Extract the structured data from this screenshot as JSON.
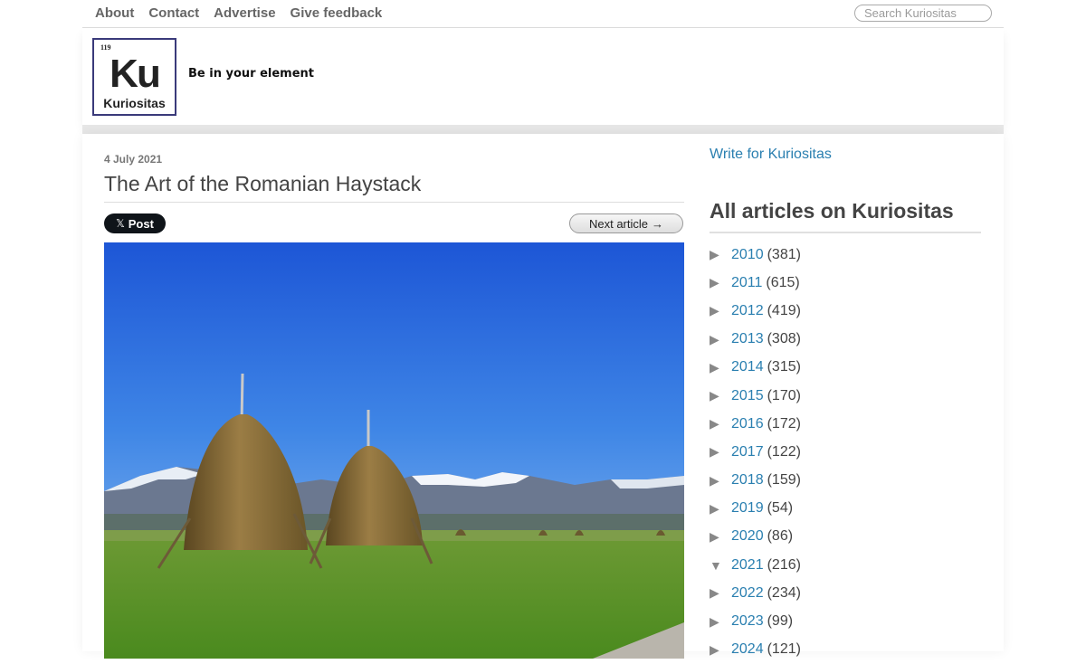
{
  "topnav": {
    "links": [
      "About",
      "Contact",
      "Advertise",
      "Give feedback"
    ],
    "search_placeholder": "Search Kuriositas"
  },
  "logo": {
    "number": "119",
    "symbol": "Ku",
    "name": "Kuriositas"
  },
  "tagline": "Be in your element",
  "article": {
    "date": "4 July 2021",
    "title": "The Art of the Romanian Haystack",
    "post_label": "Post",
    "post_icon": "x-logo-icon",
    "next_label": "Next article",
    "next_icon": "right-arrow-icon"
  },
  "sidebar": {
    "write_link": "Write for Kuriositas",
    "archive_title": "All articles on Kuriositas",
    "archive": [
      {
        "year": "2010",
        "count": "(381)",
        "expanded": false
      },
      {
        "year": "2011",
        "count": "(615)",
        "expanded": false
      },
      {
        "year": "2012",
        "count": "(419)",
        "expanded": false
      },
      {
        "year": "2013",
        "count": "(308)",
        "expanded": false
      },
      {
        "year": "2014",
        "count": "(315)",
        "expanded": false
      },
      {
        "year": "2015",
        "count": "(170)",
        "expanded": false
      },
      {
        "year": "2016",
        "count": "(172)",
        "expanded": false
      },
      {
        "year": "2017",
        "count": "(122)",
        "expanded": false
      },
      {
        "year": "2018",
        "count": "(159)",
        "expanded": false
      },
      {
        "year": "2019",
        "count": "(54)",
        "expanded": false
      },
      {
        "year": "2020",
        "count": "(86)",
        "expanded": false
      },
      {
        "year": "2021",
        "count": "(216)",
        "expanded": true
      },
      {
        "year": "2022",
        "count": "(234)",
        "expanded": false
      },
      {
        "year": "2023",
        "count": "(99)",
        "expanded": false
      },
      {
        "year": "2024",
        "count": "(121)",
        "expanded": false
      }
    ]
  },
  "colors": {
    "link": "#2a7fb0",
    "nav_text": "#666666",
    "logo_border": "#3a3a7a"
  }
}
